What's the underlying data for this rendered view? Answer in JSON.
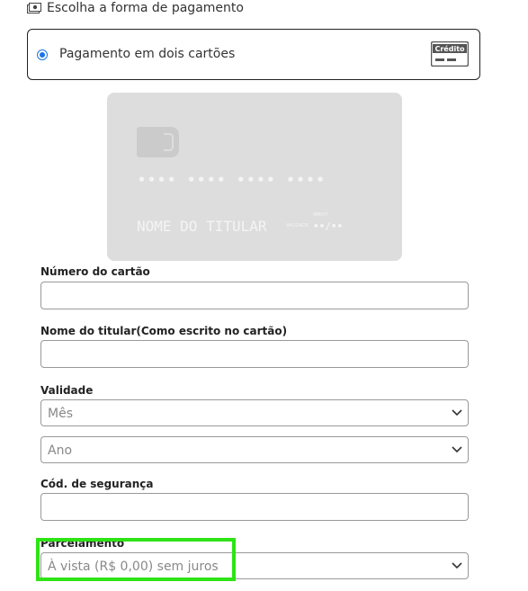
{
  "header": {
    "title": "Escolha a forma de pagamento",
    "icon": "money-icon"
  },
  "payment_option": {
    "label": "Pagamento em dois cartões",
    "badge": "Crédito",
    "selected": true
  },
  "card_preview": {
    "number": "•••• •••• •••• ••••",
    "holder": "NOME DO TITULAR",
    "valid_label": "VALIDADE",
    "valid_top": "MM/YY",
    "valid_value": "••/••"
  },
  "form": {
    "card_number_label": "Número do cartão",
    "holder_label": "Nome do titular(Como escrito no cartão)",
    "validity_label": "Validade",
    "month_value": "Mês",
    "year_value": "Ano",
    "cvv_label": "Cód. de segurança",
    "installments_label": "Parcelamento",
    "installments_value": "À vista (R$ 0,00) sem juros"
  },
  "colors": {
    "radio": "#1a73e8",
    "highlight": "#2ee316",
    "card": "#dddddd"
  }
}
